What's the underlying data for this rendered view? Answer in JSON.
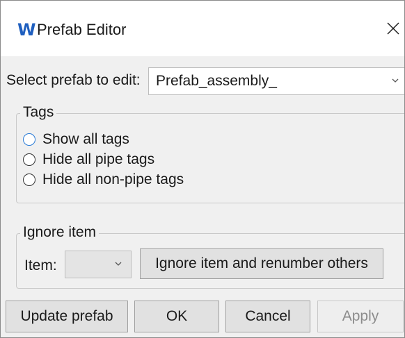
{
  "window": {
    "title": "Prefab Editor",
    "app_icon_glyph": "W",
    "icon": "app-logo-icon",
    "close_icon": "close-icon",
    "accent_color": "#1f5fbf"
  },
  "select_prefab": {
    "label": "Select prefab to edit:",
    "value": "Prefab_assembly_",
    "icon": "chevron-down-icon"
  },
  "tags_group": {
    "legend": "Tags",
    "options": [
      {
        "label": "Show all tags",
        "selected": false,
        "focused": true
      },
      {
        "label": "Hide all pipe tags",
        "selected": false,
        "focused": false
      },
      {
        "label": "Hide all non-pipe tags",
        "selected": false,
        "focused": false
      }
    ]
  },
  "ignore_group": {
    "legend": "Ignore item",
    "item_label": "Item:",
    "item_value": "",
    "ignore_button": "Ignore item and renumber others"
  },
  "footer": {
    "update_prefab": "Update prefab",
    "ok": "OK",
    "cancel": "Cancel",
    "apply": "Apply",
    "apply_enabled": false
  }
}
